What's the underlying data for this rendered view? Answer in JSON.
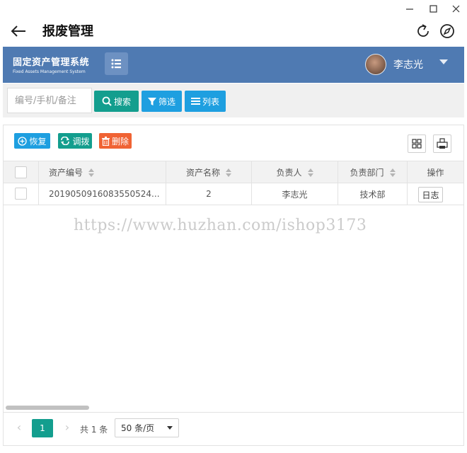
{
  "window": {
    "title": "报废管理",
    "minimize_glyph": "—",
    "maximize_glyph": "☐",
    "close_glyph": "✕"
  },
  "brand": {
    "name_cn": "固定资产管理系统",
    "name_en": "Fixed Assets Management System"
  },
  "user": {
    "name": "李志光"
  },
  "search": {
    "placeholder": "编号/手机/备注",
    "search_label": "搜索",
    "filter_label": "筛选",
    "list_label": "列表"
  },
  "actions": {
    "restore_label": "恢复",
    "transfer_label": "调拨",
    "delete_label": "删除"
  },
  "table": {
    "columns": [
      "资产编号",
      "资产名称",
      "负责人",
      "负责部门",
      "操作"
    ],
    "rows": [
      {
        "asset_code": "2019050916083550524...",
        "asset_name": "2",
        "owner": "李志光",
        "department": "技术部",
        "action_label": "日志"
      }
    ]
  },
  "watermark": "https://www.huzhan.com/ishop3173",
  "pagination": {
    "current_page": "1",
    "total_text": "共 1 条",
    "page_size": "50 条/页"
  },
  "colors": {
    "header_bg": "#4f7ab2",
    "teal": "#139e8e",
    "blue": "#1e9fe0",
    "orange": "#f06334"
  },
  "icons": {
    "back": "arrow-left-icon",
    "refresh": "refresh-icon",
    "compass": "compass-icon",
    "menu": "list-icon",
    "search": "magnifier-icon",
    "filter": "funnel-icon",
    "list": "bars-icon",
    "restore": "plus-circle-icon",
    "transfer": "swap-icon",
    "delete": "trash-icon",
    "columns": "grid-icon",
    "export": "print-icon"
  }
}
